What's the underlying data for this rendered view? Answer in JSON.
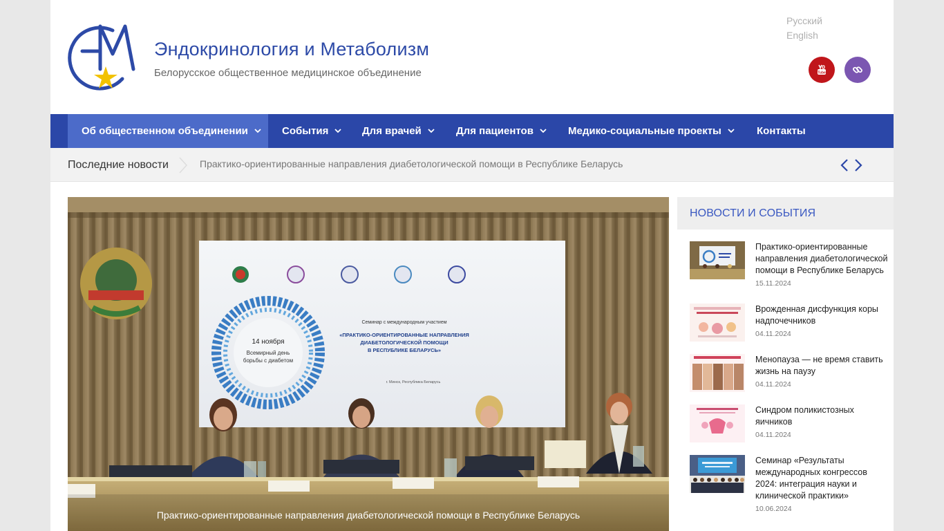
{
  "site": {
    "title": "Эндокринология и Метаболизм",
    "description": "Белорусское общественное медицинское объединение",
    "logo_letters": "EM"
  },
  "languages": [
    {
      "label": "Русский"
    },
    {
      "label": "English"
    }
  ],
  "social": [
    {
      "icon": "youtube-icon",
      "color": "#c0161b"
    },
    {
      "icon": "link-icon",
      "color": "#7b56b1"
    }
  ],
  "nav": {
    "items": [
      {
        "label": "Об общественном объединении",
        "has_dropdown": true,
        "active": true
      },
      {
        "label": "События",
        "has_dropdown": true
      },
      {
        "label": "Для врачей",
        "has_dropdown": true
      },
      {
        "label": "Для пациентов",
        "has_dropdown": true
      },
      {
        "label": "Медико-социальные проекты",
        "has_dropdown": true
      },
      {
        "label": "Контакты",
        "has_dropdown": false
      }
    ]
  },
  "ticker": {
    "label": "Последние новости",
    "text": "Практико-ориентированные направления диабетологической помощи в Республике Беларусь"
  },
  "slide": {
    "caption": "Практико-ориентированные направления диабетологической помощи в Республике Беларусь",
    "screen_date": "14 ноября",
    "screen_day_line1": "Всемирный день",
    "screen_day_line2": "борьбы с диабетом",
    "screen_subtitle": "Семинар с международным участием",
    "screen_title_line1": "«ПРАКТИКО-ОРИЕНТИРОВАННЫЕ НАПРАВЛЕНИЯ",
    "screen_title_line2": "ДИАБЕТОЛОГИЧЕСКОЙ ПОМОЩИ",
    "screen_title_line3": "В РЕСПУБЛИКЕ БЕЛАРУСЬ»",
    "screen_place": "г. Минск, Республика Беларусь"
  },
  "sidebar": {
    "widget_title": "НОВОСТИ И СОБЫТИЯ",
    "news": [
      {
        "title": "Практико-ориентированные направления диабетологической помощи в Республике Беларусь",
        "date": "15.11.2024"
      },
      {
        "title": "Врожденная дисфункция коры надпочечников",
        "date": "04.11.2024"
      },
      {
        "title": "Менопауза — не время ставить жизнь на паузу",
        "date": "04.11.2024"
      },
      {
        "title": "Синдром поликистозных яичников",
        "date": "04.11.2024"
      },
      {
        "title": "Семинар «Результаты международных конгрессов 2024: интеграция науки и клинической практики»",
        "date": "10.06.2024"
      }
    ]
  },
  "colors": {
    "brand_blue": "#2b47a8",
    "nav_active": "#4c6bc9",
    "title_blue": "#2d4aa7",
    "logo_star": "#f2c200"
  }
}
